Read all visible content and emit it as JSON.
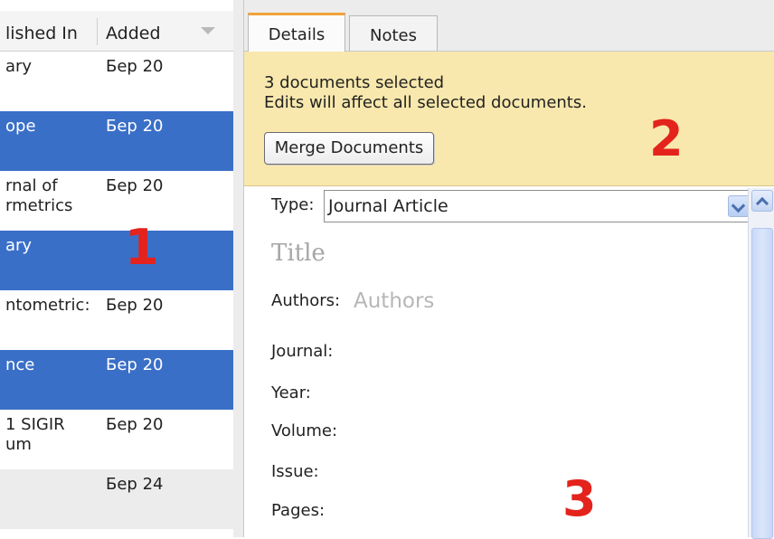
{
  "list": {
    "columns": {
      "published_in": "lished In",
      "added": "Added"
    },
    "rows": [
      {
        "published_in": "ary",
        "added": "Бер 20",
        "selected": false
      },
      {
        "published_in": "ope",
        "added": "Бер 20",
        "selected": true
      },
      {
        "published_in": "rnal of rmetrics",
        "added": "Бер 20",
        "selected": false
      },
      {
        "published_in": "ary",
        "added": "",
        "selected": true
      },
      {
        "published_in": "ntometric:",
        "added": "Бер 20",
        "selected": false
      },
      {
        "published_in": "nce",
        "added": "Бер 20",
        "selected": true
      },
      {
        "published_in": "1 SIGIR um",
        "added": "Бер 20",
        "selected": false
      },
      {
        "published_in": "",
        "added": "Бер 24",
        "selected": false
      }
    ],
    "selection_color": "#3a6fc8"
  },
  "tabs": {
    "details": "Details",
    "notes": "Notes",
    "active": "Details"
  },
  "banner": {
    "line1": "3 documents selected",
    "line2": "Edits will affect all selected documents.",
    "merge_button": "Merge Documents"
  },
  "form": {
    "type_label": "Type:",
    "type_value": "Journal Article",
    "title_placeholder": "Title",
    "authors_label": "Authors:",
    "authors_placeholder": "Authors",
    "journal_label": "Journal:",
    "year_label": "Year:",
    "volume_label": "Volume:",
    "issue_label": "Issue:",
    "pages_label": "Pages:"
  },
  "markers": {
    "m1": "1",
    "m2": "2",
    "m3": "3",
    "color": "#e3231c"
  },
  "icons": {
    "sort": "sort-desc-icon",
    "dropdown": "chevron-down-icon",
    "scroll_up": "chevron-up-icon"
  }
}
